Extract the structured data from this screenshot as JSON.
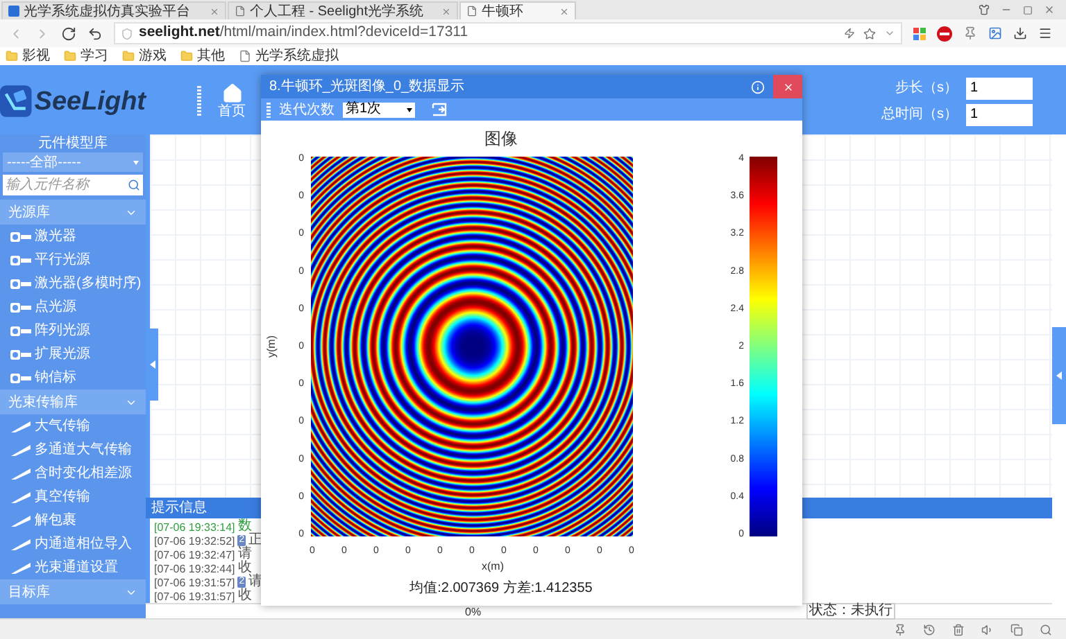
{
  "browser": {
    "tabs": [
      {
        "title": "光学系统虚拟仿真实验平台",
        "selected": false
      },
      {
        "title": "个人工程 - Seelight光学系统",
        "selected": false
      },
      {
        "title": "牛顿环",
        "selected": true
      }
    ],
    "url_host": "seelight.net",
    "url_path": "/html/main/index.html?deviceId=17311",
    "bookmarks": [
      {
        "label": "影视",
        "kind": "folder"
      },
      {
        "label": "学习",
        "kind": "folder"
      },
      {
        "label": "游戏",
        "kind": "folder"
      },
      {
        "label": "其他",
        "kind": "folder"
      },
      {
        "label": "光学系统虚拟",
        "kind": "page"
      }
    ]
  },
  "app": {
    "logo": "SeeLight",
    "home": "首页",
    "fields": [
      {
        "label": "步长（s）",
        "value": "1"
      },
      {
        "label": "总时间（s）",
        "value": "1"
      }
    ]
  },
  "sidebar": {
    "title": "元件模型库",
    "filter": "-----全部-----",
    "search_placeholder": "输入元件名称",
    "sections": [
      {
        "title": "光源库",
        "items": [
          "激光器",
          "平行光源",
          "激光器(多模时序)",
          "点光源",
          "阵列光源",
          "扩展光源",
          "钠信标"
        ]
      },
      {
        "title": "光束传输库",
        "items": [
          "大气传输",
          "多通道大气传输",
          "含时变化相差源",
          "真空传输",
          "解包裹",
          "内通道相位导入",
          "光束通道设置"
        ]
      },
      {
        "title": "目标库"
      }
    ]
  },
  "messages": {
    "title": "提示信息",
    "lines": [
      {
        "time": "[07-06 19:33:14]",
        "text": "数",
        "color": "#2e9e3e"
      },
      {
        "time": "[07-06 19:32:52]",
        "badge": "2",
        "text": "正",
        "color": "#555555"
      },
      {
        "time": "[07-06 19:32:47]",
        "text": "请",
        "color": "#555555"
      },
      {
        "time": "[07-06 19:32:44]",
        "text": "收",
        "color": "#555555"
      },
      {
        "time": "[07-06 19:31:57]",
        "badge": "2",
        "text": "请",
        "color": "#555555"
      },
      {
        "time": "[07-06 19:31:57]",
        "text": "收",
        "color": "#555555"
      }
    ]
  },
  "status": {
    "progress": "0%",
    "state": "状态：未执行"
  },
  "dialog": {
    "title": "8.牛顿环_光斑图像_0_数据显示",
    "iteration_label": "迭代次数",
    "iteration": "第1次",
    "chart_title": "图像",
    "xlabel": "x(m)",
    "ylabel": "y(m)",
    "yticks": [
      "0",
      "0",
      "0",
      "0",
      "0",
      "0",
      "0",
      "0",
      "0",
      "0",
      "0"
    ],
    "xticks": [
      "0",
      "0",
      "0",
      "0",
      "0",
      "0",
      "0",
      "0",
      "0",
      "0",
      "0"
    ],
    "colorbar_ticks": [
      "4",
      "3.6",
      "3.2",
      "2.8",
      "2.4",
      "2",
      "1.6",
      "1.2",
      "0.8",
      "0.4",
      "0"
    ],
    "footer": "均值:2.007369 方差:1.412355"
  }
}
